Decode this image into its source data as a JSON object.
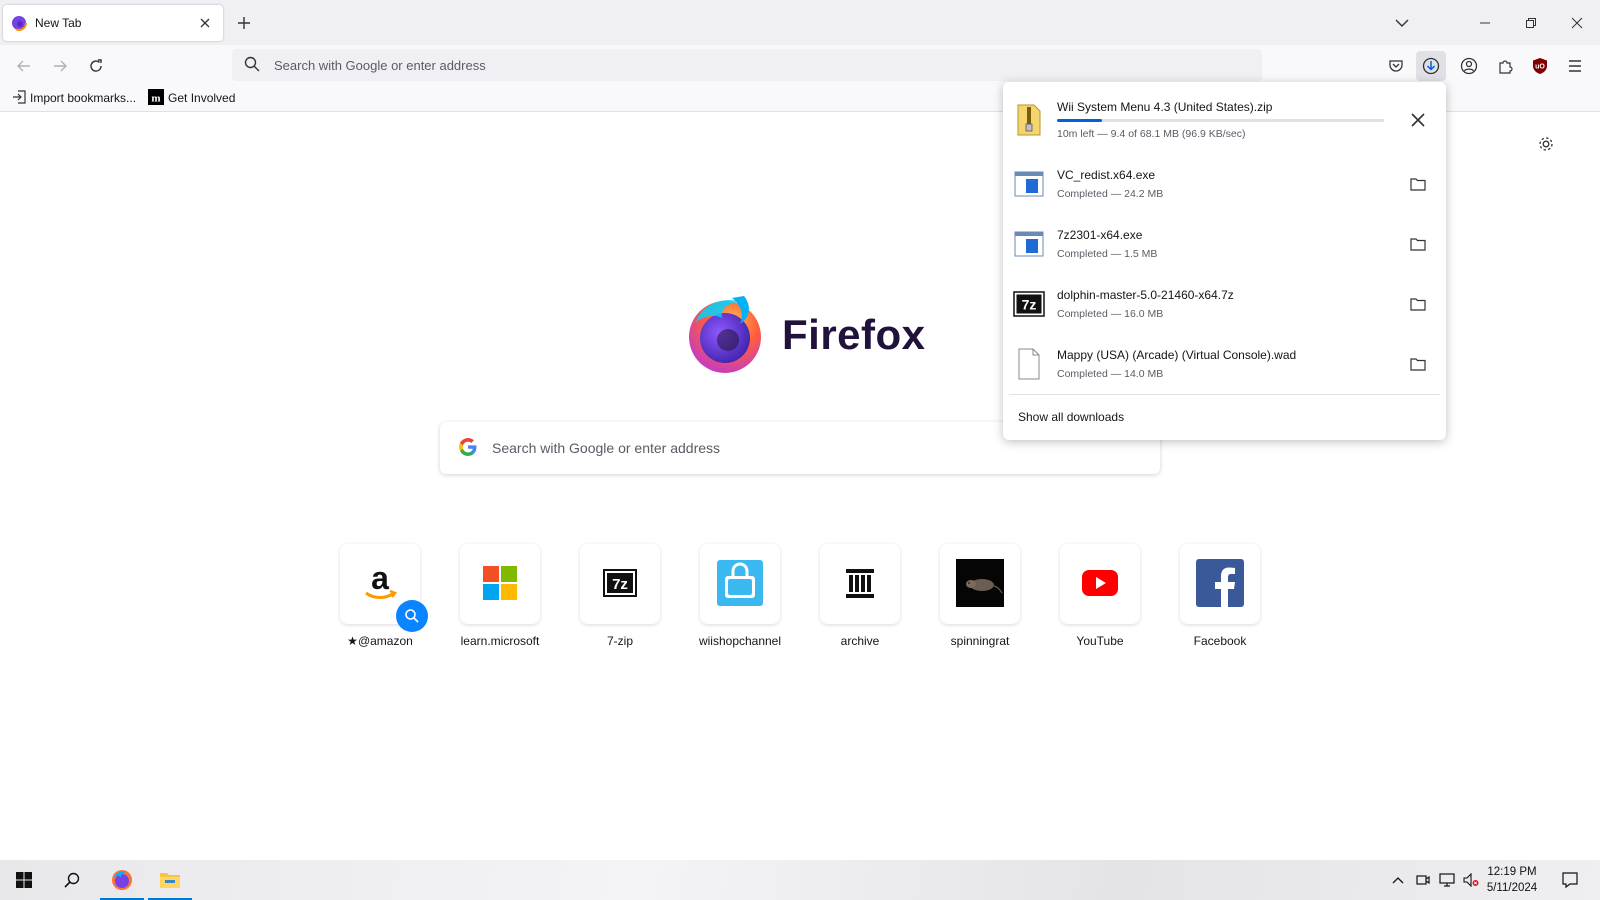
{
  "tab": {
    "title": "New Tab"
  },
  "urlbar": {
    "placeholder": "Search with Google or enter address"
  },
  "bookmarks": [
    {
      "label": "Import bookmarks...",
      "icon": "import-icon"
    },
    {
      "label": "Get Involved",
      "icon": "mozilla-icon"
    }
  ],
  "brand": {
    "name": "Firefox"
  },
  "search": {
    "placeholder": "Search with Google or enter address"
  },
  "shortcuts": [
    {
      "label": "@amazon",
      "icon": "amazon-icon",
      "sponsored_pin": true
    },
    {
      "label": "learn.microsoft",
      "icon": "microsoft-icon"
    },
    {
      "label": "7-zip",
      "icon": "7zip-icon"
    },
    {
      "label": "wiishopchannel",
      "icon": "shopping-bag-icon"
    },
    {
      "label": "archive",
      "icon": "archive-icon"
    },
    {
      "label": "spinningrat",
      "icon": "rat-icon"
    },
    {
      "label": "YouTube",
      "icon": "youtube-icon"
    },
    {
      "label": "Facebook",
      "icon": "facebook-icon"
    }
  ],
  "downloads": {
    "items": [
      {
        "name": "Wii System Menu 4.3 (United States).zip",
        "status": "10m left — 9.4 of 68.1 MB (96.9 KB/sec)",
        "progress": 0.138,
        "icon": "zip-icon",
        "action": "cancel"
      },
      {
        "name": "VC_redist.x64.exe",
        "status": "Completed — 24.2 MB",
        "icon": "exe-icon",
        "action": "folder"
      },
      {
        "name": "7z2301-x64.exe",
        "status": "Completed — 1.5 MB",
        "icon": "exe-icon",
        "action": "folder"
      },
      {
        "name": "dolphin-master-5.0-21460-x64.7z",
        "status": "Completed — 16.0 MB",
        "icon": "7z-icon",
        "action": "folder"
      },
      {
        "name": "Mappy (USA) (Arcade) (Virtual Console).wad",
        "status": "Completed — 14.0 MB",
        "icon": "file-icon",
        "action": "folder"
      }
    ],
    "show_all": "Show all downloads"
  },
  "taskbar": {
    "time": "12:19 PM",
    "date": "5/11/2024"
  },
  "colors": {
    "accent": "#0061e0",
    "tabstrip": "#f0f0f4",
    "navbar": "#f9f9fb",
    "ublock": "#800000",
    "youtube": "#ff0000",
    "facebook": "#1877f2"
  }
}
